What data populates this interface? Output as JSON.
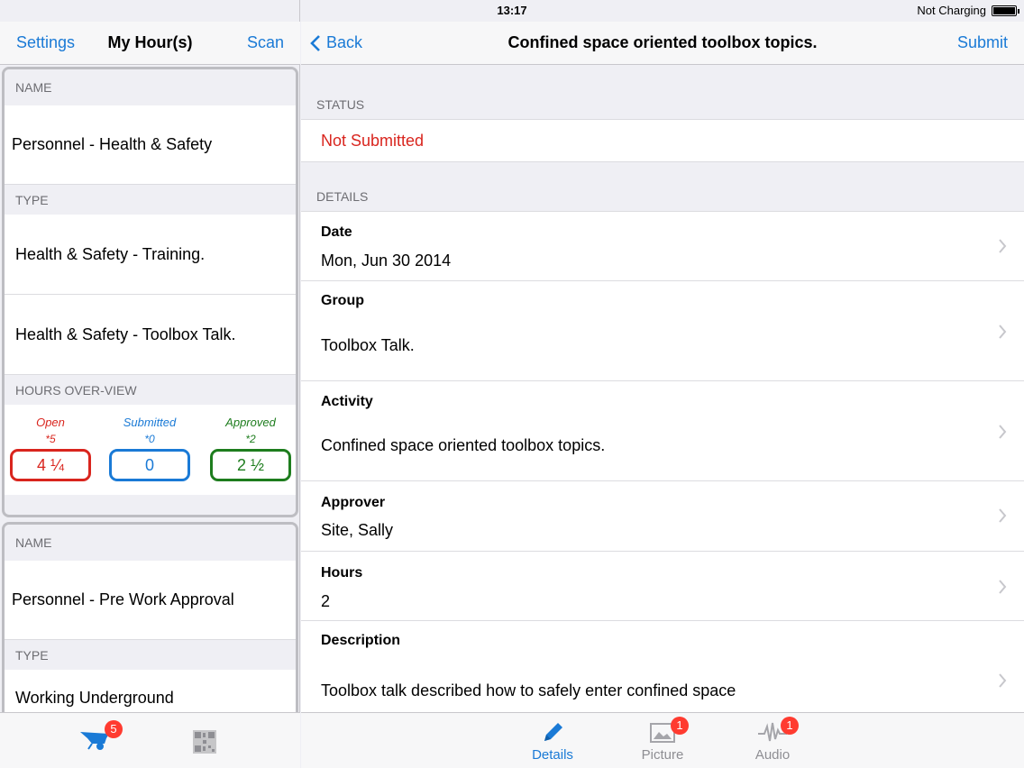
{
  "status_bar": {
    "device": "iPad",
    "time": "13:17",
    "charging": "Not Charging"
  },
  "left": {
    "nav": {
      "settings": "Settings",
      "title": "My Hour(s)",
      "scan": "Scan"
    },
    "cards": [
      {
        "name_header": "NAME",
        "name": "Personnel - Health & Safety",
        "type_header": "TYPE",
        "types": [
          "Health & Safety - Training.",
          "Health & Safety - Toolbox Talk."
        ],
        "overview_header": "HOURS OVER-VIEW",
        "overview": [
          {
            "label": "Open",
            "count": "*5",
            "value": "4 ¼",
            "color": "#d9251e"
          },
          {
            "label": "Submitted",
            "count": "*0",
            "value": "0",
            "color": "#1a7ad6"
          },
          {
            "label": "Approved",
            "count": "*2",
            "value": "2 ½",
            "color": "#1e7d1e"
          }
        ]
      },
      {
        "name_header": "NAME",
        "name": "Personnel - Pre Work Approval",
        "type_header": "TYPE",
        "types": [
          "Working Underground"
        ]
      }
    ],
    "tabbar": {
      "badge": "5",
      "icons": [
        "wheelbarrow-icon",
        "qr-code-icon"
      ]
    }
  },
  "right": {
    "nav": {
      "back": "Back",
      "title": "Confined space oriented toolbox topics.",
      "submit": "Submit"
    },
    "status_header": "STATUS",
    "status": "Not Submitted",
    "details_header": "DETAILS",
    "details": [
      {
        "label": "Date",
        "value": "Mon, Jun 30 2014"
      },
      {
        "label": "Group",
        "value": "Toolbox Talk."
      },
      {
        "label": "Activity",
        "value": "Confined space oriented toolbox topics."
      },
      {
        "label": "Approver",
        "value": "Site, Sally"
      },
      {
        "label": "Hours",
        "value": "2"
      },
      {
        "label": "Description",
        "value": "Toolbox talk described how to safely enter confined space"
      }
    ],
    "tabbar": {
      "details": "Details",
      "picture": "Picture",
      "picture_badge": "1",
      "audio": "Audio",
      "audio_badge": "1"
    }
  },
  "colors": {
    "accent": "#1a7ad6",
    "status_red": "#d9251e",
    "approved_green": "#1e7d1e"
  }
}
